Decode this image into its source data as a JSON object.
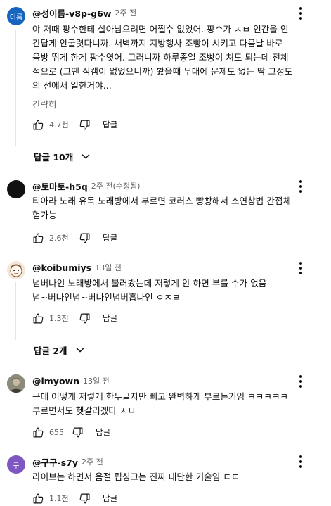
{
  "comments": [
    {
      "author": "@성이름-v8p-g6w",
      "time": "2주 전",
      "avatar_text": "이름",
      "avatar_color": "#1565c0",
      "text": "야 저때 팡수한테 살아남으려면 어쩔수 없었어. 팡수가 ㅅㅂ 인간을 인\n간답게 안굴렷다니까. 새벽까지 지방행사 조빵이 시키고 다음날 바로\n음방 뛰게 한게 팡수엿어. 그러니까 하루종일 조빵이 쳐도 되는데 전체\n적으로 (그땐 직캠이 없었으니까) 봤을때 무대에 문제도 없는 딱 그정도\n의 선에서 일한거야...",
      "more_label": "간략히",
      "likes": "4.7천",
      "reply_label": "답글",
      "replies_toggle": "답글 10개"
    },
    {
      "author": "@토마토-h5q",
      "time": "2주 전(수정됨)",
      "avatar_color": "#111111",
      "text": "티아라 노래 유독 노래방에서 부르면 코러스 빵빵해서 소연창법 간접체\n험가능",
      "likes": "2.6천",
      "reply_label": "답글"
    },
    {
      "author": "@koibumiys",
      "time": "13일 전",
      "avatar_color": "#f1e6d8",
      "text": "넘버나인 노래방에서 불러봤는데 저렇게 안 하면 부를 수가 없음\n넘~버나인넘~버나인넘버흡나인 ㅇㅈㄹ",
      "likes": "1.3천",
      "reply_label": "답글",
      "replies_toggle": "답글 2개"
    },
    {
      "author": "@imyown",
      "time": "13일 전",
      "avatar_color": "#6b6b5a",
      "text": "근데 어떻게 저렇게 한두글자만 빼고 완벽하게 부르는거임 ㅋㅋㅋㅋㅋ\n부르면서도 헷갈리겠다 ㅅㅂ",
      "likes": "655",
      "reply_label": "답글"
    },
    {
      "author": "@구구-s7y",
      "time": "2주 전",
      "avatar_text": "구",
      "avatar_color": "#7e57c2",
      "text": "라이브는 하면서 음절 립싱크는 진짜 대단한 기술임 ㄷㄷ",
      "likes": "1.1천",
      "reply_label": "답글"
    }
  ],
  "icons": {
    "like": "thumb-up-icon",
    "dislike": "thumb-down-icon",
    "menu": "more-vert-icon",
    "expand": "chevron-down-icon"
  }
}
